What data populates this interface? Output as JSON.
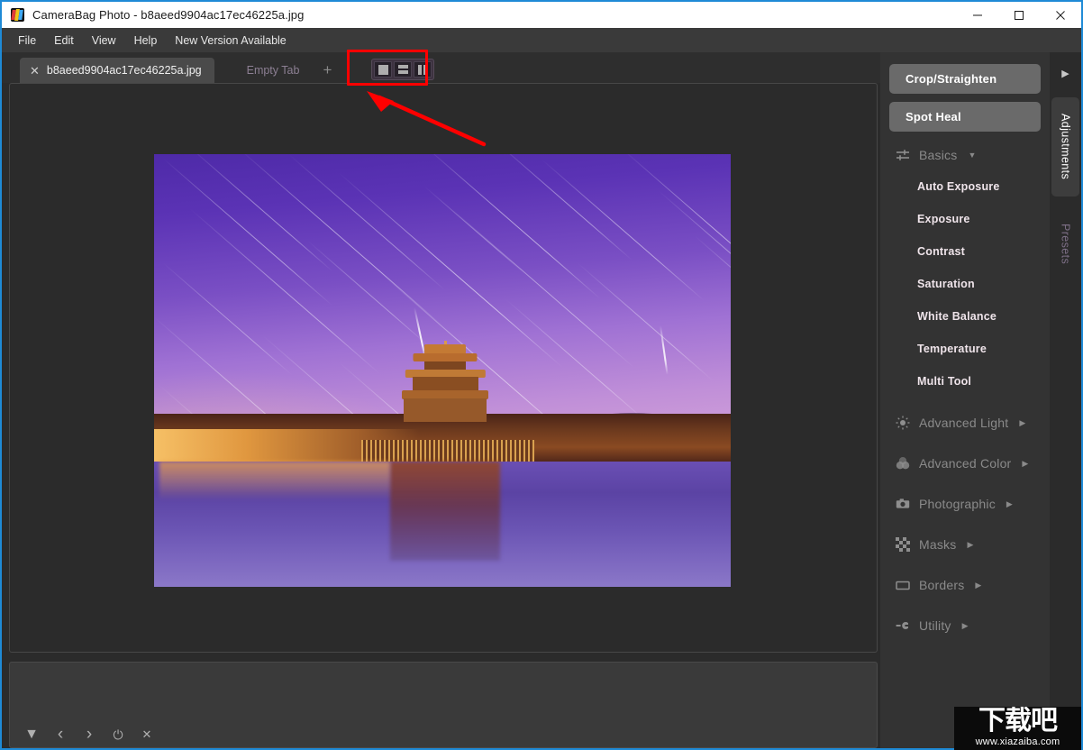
{
  "window": {
    "title": "CameraBag Photo - b8aeed9904ac17ec46225a.jpg",
    "app_logo_icon": "camerabag-logo-icon",
    "controls": {
      "minimize": "minimize-icon",
      "maximize": "maximize-icon",
      "close": "close-icon"
    }
  },
  "menubar": {
    "items": [
      {
        "label": "File"
      },
      {
        "label": "Edit"
      },
      {
        "label": "View"
      },
      {
        "label": "Help"
      },
      {
        "label": "New Version Available"
      }
    ]
  },
  "tabbar": {
    "active_tab": {
      "label": "b8aeed9904ac17ec46225a.jpg",
      "close_icon": "close-icon"
    },
    "empty_tab_label": "Empty Tab",
    "add_tab_icon": "plus-icon",
    "view_modes": [
      {
        "name": "single-pane",
        "icon": "single-pane-icon",
        "selected": true
      },
      {
        "name": "horizontal-split",
        "icon": "horizontal-split-icon",
        "selected": false
      },
      {
        "name": "vertical-split",
        "icon": "vertical-split-icon",
        "selected": false
      }
    ]
  },
  "canvas": {
    "image_description": "Forbidden City corner tower at dusk with purple sky, star trails and moat reflection"
  },
  "filmstrip": {
    "tools": [
      {
        "name": "dropdown-toggle",
        "icon": "triangle-down-icon",
        "glyph": "▼"
      },
      {
        "name": "previous-image",
        "icon": "chevron-left-icon",
        "glyph": "‹"
      },
      {
        "name": "next-image",
        "icon": "chevron-right-icon",
        "glyph": "›"
      },
      {
        "name": "reset",
        "icon": "power-icon",
        "glyph": "⏻"
      },
      {
        "name": "close-filmstrip",
        "icon": "close-icon",
        "glyph": "✕"
      }
    ]
  },
  "right_panel": {
    "tools": [
      {
        "label": "Crop/Straighten"
      },
      {
        "label": "Spot Heal"
      }
    ],
    "categories": [
      {
        "label": "Basics",
        "icon": "sliders-icon",
        "expanded": true,
        "caret": "▼",
        "items": [
          {
            "label": "Auto Exposure"
          },
          {
            "label": "Exposure"
          },
          {
            "label": "Contrast"
          },
          {
            "label": "Saturation"
          },
          {
            "label": "White Balance"
          },
          {
            "label": "Temperature"
          },
          {
            "label": "Multi Tool"
          }
        ]
      },
      {
        "label": "Advanced Light",
        "icon": "sun-icon",
        "expanded": false,
        "caret": "▶",
        "items": []
      },
      {
        "label": "Advanced Color",
        "icon": "color-circles-icon",
        "expanded": false,
        "caret": "▶",
        "items": []
      },
      {
        "label": "Photographic",
        "icon": "camera-icon",
        "expanded": false,
        "caret": "▶",
        "items": []
      },
      {
        "label": "Masks",
        "icon": "checkerboard-icon",
        "expanded": false,
        "caret": "▶",
        "items": []
      },
      {
        "label": "Borders",
        "icon": "rectangle-icon",
        "expanded": false,
        "caret": "▶",
        "items": []
      },
      {
        "label": "Utility",
        "icon": "wrench-icon",
        "expanded": false,
        "caret": "▶",
        "items": []
      }
    ]
  },
  "side_tabs": {
    "expand_icon": "triangle-right-icon",
    "expand_glyph": "▶",
    "tabs": [
      {
        "label": "Adjustments",
        "active": true
      },
      {
        "label": "Presets",
        "active": false
      }
    ]
  },
  "annotation": {
    "highlight_color": "#ff0000",
    "target": "view-mode-buttons"
  },
  "watermark": {
    "text": "下载吧",
    "url": "www.xiazaiba.com"
  },
  "colors": {
    "accent_border": "#1e8ad6",
    "panel_bg": "#333333",
    "tool_button": "#6a6a6a",
    "canvas_bg": "#2b2b2b",
    "annotation": "#ff0000"
  }
}
